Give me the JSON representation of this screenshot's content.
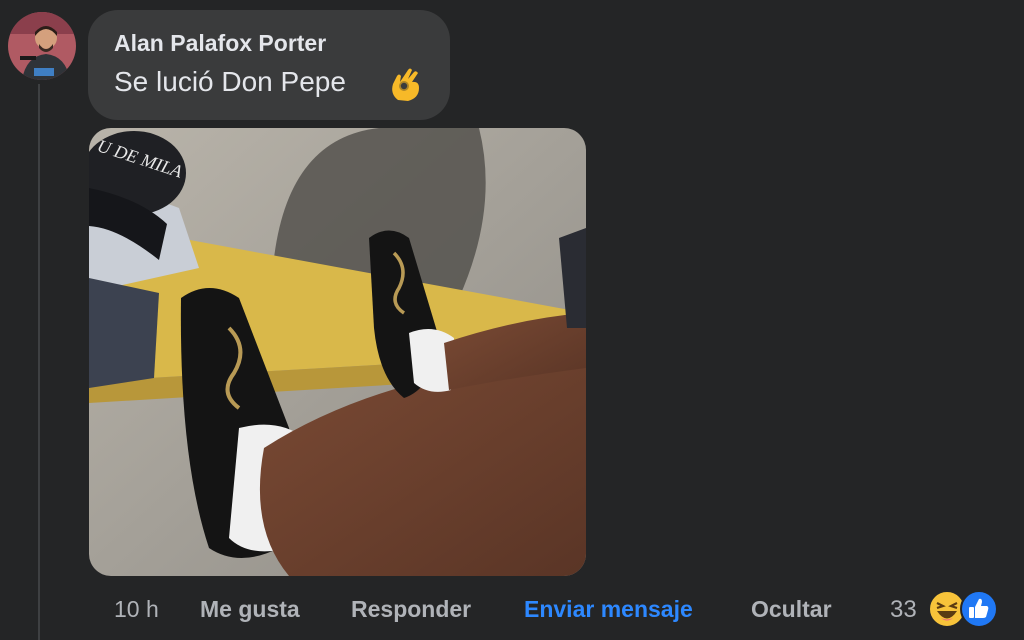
{
  "comment": {
    "author": "Alan Palafox Porter",
    "text": "Se lució Don Pepe",
    "emoji": "ok-hand-emoji"
  },
  "actions": {
    "time": "10 h",
    "like": "Me gusta",
    "reply": "Responder",
    "send_message": "Enviar mensaje",
    "hide": "Ocultar"
  },
  "reactions": {
    "count": "33",
    "icons": [
      "haha-reaction-icon",
      "like-reaction-icon"
    ]
  },
  "colors": {
    "background": "#242526",
    "bubble": "#3a3b3c",
    "text": "#e4e6eb",
    "muted": "#b0b3b8",
    "link_blue": "#2d88ff"
  }
}
